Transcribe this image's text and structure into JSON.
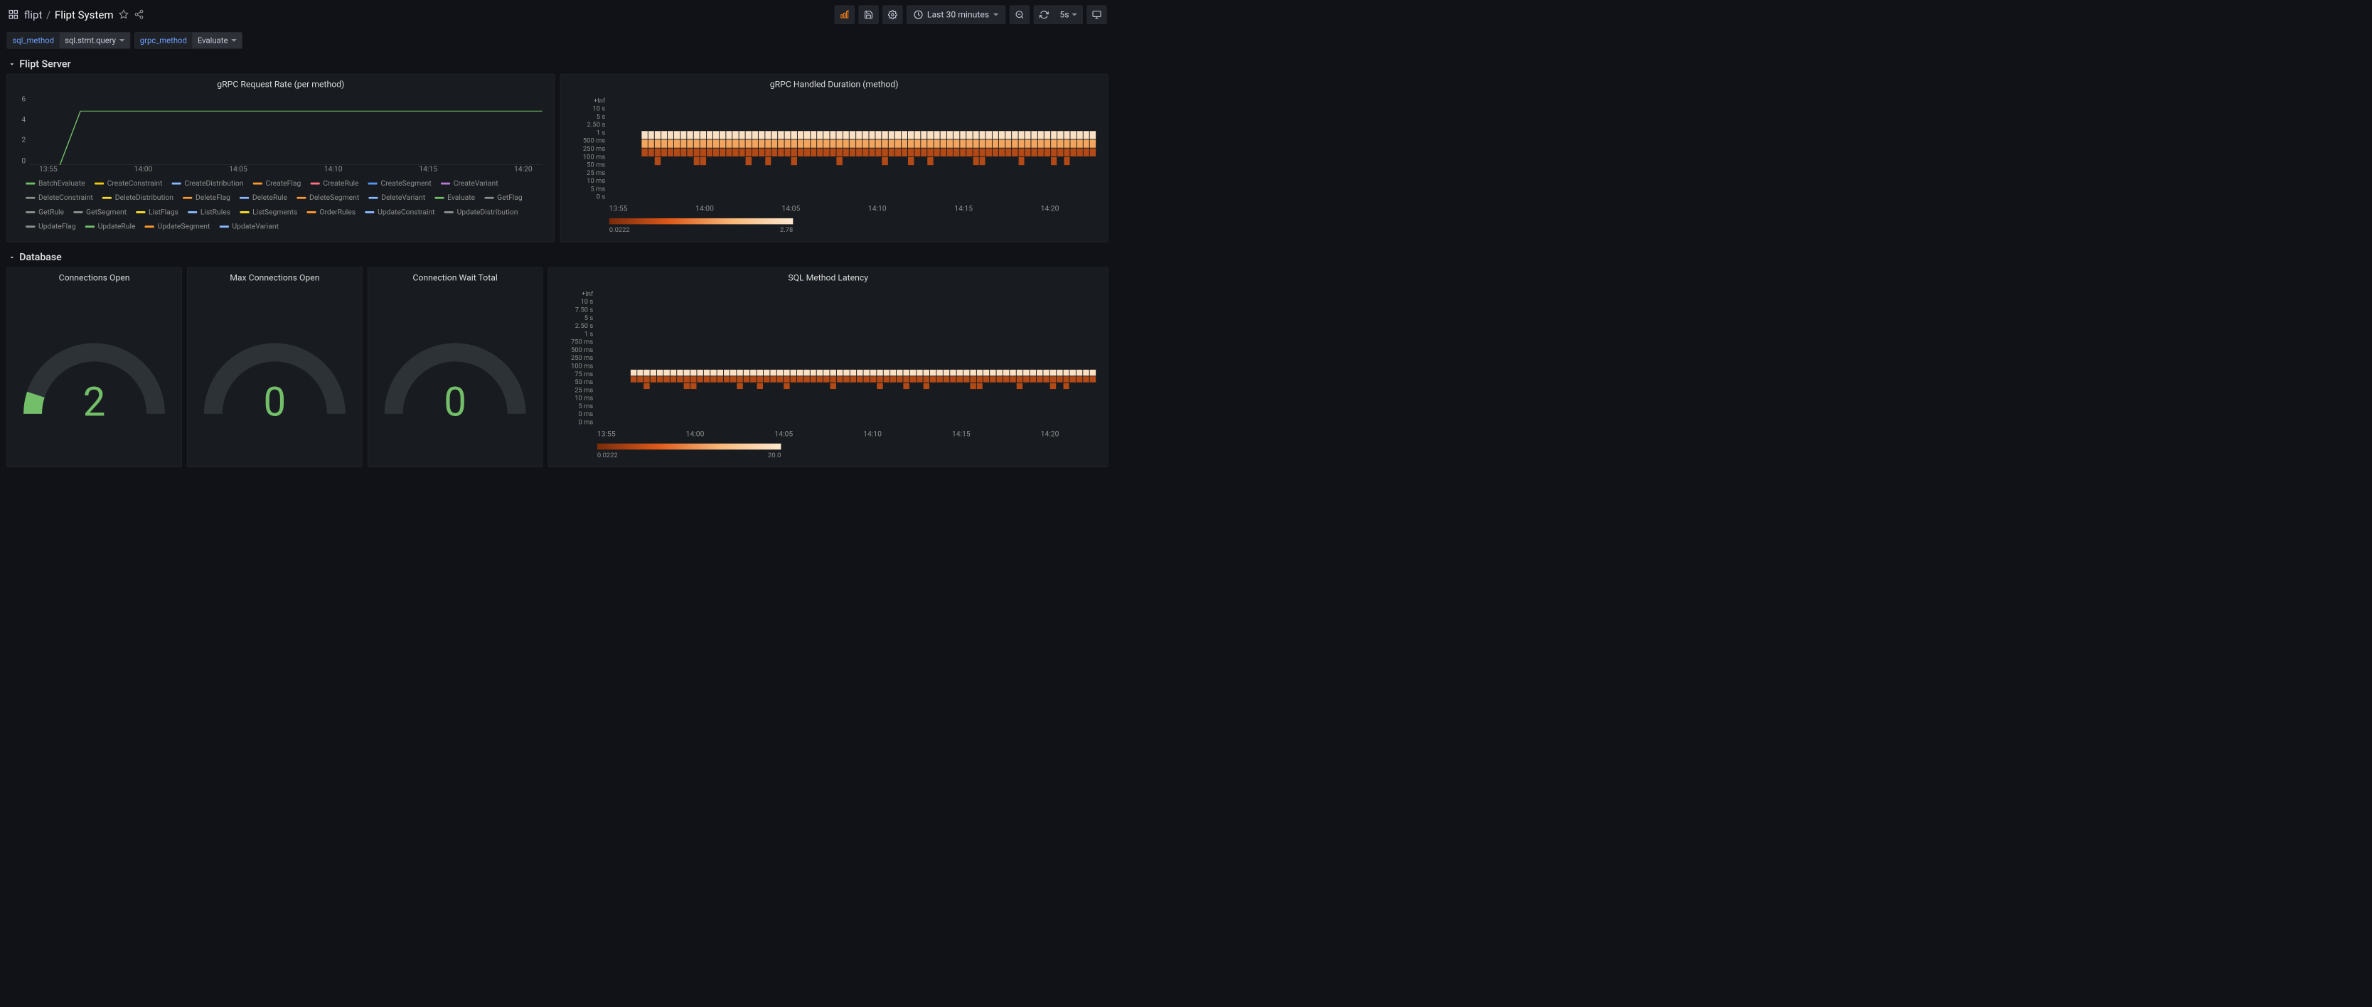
{
  "breadcrumb": {
    "folder": "flipt",
    "title": "Flipt System"
  },
  "time_range": "Last 30 minutes",
  "refresh_interval": "5s",
  "variables": [
    {
      "label": "sql_method",
      "value": "sql.stmt.query"
    },
    {
      "label": "grpc_method",
      "value": "Evaluate"
    }
  ],
  "rows": {
    "server": "Flipt Server",
    "database": "Database"
  },
  "panels": {
    "grpc_rate": {
      "title": "gRPC Request Rate (per method)",
      "y_ticks": [
        "6",
        "4",
        "2",
        "0"
      ],
      "x_ticks": [
        "13:55",
        "14:00",
        "14:05",
        "14:10",
        "14:15",
        "14:20"
      ]
    },
    "grpc_duration": {
      "title": "gRPC Handled Duration (method)",
      "y_ticks": [
        "+Inf",
        "10 s",
        "5 s",
        "2.50 s",
        "1 s",
        "500 ms",
        "250 ms",
        "100 ms",
        "50 ms",
        "25 ms",
        "10 ms",
        "5 ms",
        "0 s"
      ],
      "x_ticks": [
        "13:55",
        "14:00",
        "14:05",
        "14:10",
        "14:15",
        "14:20"
      ],
      "legend_min": "0.0222",
      "legend_max": "2.78"
    },
    "conn_open": {
      "title": "Connections Open",
      "value": "2",
      "color": "#73bf69"
    },
    "max_conn": {
      "title": "Max Connections Open",
      "value": "0",
      "color": "#73bf69"
    },
    "conn_wait": {
      "title": "Connection Wait Total",
      "value": "0",
      "color": "#73bf69"
    },
    "sql_latency": {
      "title": "SQL Method Latency",
      "y_ticks": [
        "+Inf",
        "10 s",
        "7.50 s",
        "5 s",
        "2.50 s",
        "1 s",
        "750 ms",
        "500 ms",
        "250 ms",
        "100 ms",
        "75 ms",
        "50 ms",
        "25 ms",
        "10 ms",
        "5 ms",
        "0 ms",
        "0 ms"
      ],
      "x_ticks": [
        "13:55",
        "14:00",
        "14:05",
        "14:10",
        "14:15",
        "14:20"
      ],
      "legend_min": "0.0222",
      "legend_max": "20.0"
    }
  },
  "chart_data": {
    "grpc_rate": {
      "type": "line",
      "xlim": [
        "13:53",
        "14:23"
      ],
      "ylim": [
        0,
        6.5
      ],
      "series_visible": {
        "name": "Evaluate",
        "color": "#73bf69",
        "points": [
          [
            0.06,
            0
          ],
          [
            0.1,
            5.0
          ],
          [
            1.0,
            5.0
          ]
        ]
      },
      "legend": [
        {
          "name": "BatchEvaluate",
          "color": "#73bf69"
        },
        {
          "name": "CreateConstraint",
          "color": "#f2cc0c"
        },
        {
          "name": "CreateDistribution",
          "color": "#8ab8ff"
        },
        {
          "name": "CreateFlag",
          "color": "#ff9830"
        },
        {
          "name": "CreateRule",
          "color": "#ff7383"
        },
        {
          "name": "CreateSegment",
          "color": "#5794f2"
        },
        {
          "name": "CreateVariant",
          "color": "#b877d9"
        },
        {
          "name": "DeleteConstraint",
          "color": "#8e8e8e"
        },
        {
          "name": "DeleteDistribution",
          "color": "#fade2a"
        },
        {
          "name": "DeleteFlag",
          "color": "#ff9830"
        },
        {
          "name": "DeleteRule",
          "color": "#8ab8ff"
        },
        {
          "name": "DeleteSegment",
          "color": "#ff9830"
        },
        {
          "name": "DeleteVariant",
          "color": "#8ab8ff"
        },
        {
          "name": "Evaluate",
          "color": "#73bf69"
        },
        {
          "name": "GetFlag",
          "color": "#8e8e8e"
        },
        {
          "name": "GetRule",
          "color": "#8e8e8e"
        },
        {
          "name": "GetSegment",
          "color": "#8e8e8e"
        },
        {
          "name": "ListFlags",
          "color": "#fade2a"
        },
        {
          "name": "ListRules",
          "color": "#8ab8ff"
        },
        {
          "name": "ListSegments",
          "color": "#fade2a"
        },
        {
          "name": "OrderRules",
          "color": "#ff9830"
        },
        {
          "name": "UpdateConstraint",
          "color": "#8ab8ff"
        },
        {
          "name": "UpdateDistribution",
          "color": "#8e8e8e"
        },
        {
          "name": "UpdateFlag",
          "color": "#8e8e8e"
        },
        {
          "name": "UpdateRule",
          "color": "#73bf69"
        },
        {
          "name": "UpdateSegment",
          "color": "#ff9830"
        },
        {
          "name": "UpdateVariant",
          "color": "#8ab8ff"
        }
      ]
    },
    "grpc_duration": {
      "type": "heatmap",
      "active_rows": [
        5,
        6,
        7
      ],
      "sparse_row": 4,
      "cols": 75
    },
    "sql_latency": {
      "type": "heatmap",
      "active_rows": [
        2,
        3
      ],
      "sparse_row": 1,
      "cols": 75
    },
    "gauges": {
      "conn_open": 2,
      "max_conn": 0,
      "conn_wait": 0
    }
  }
}
